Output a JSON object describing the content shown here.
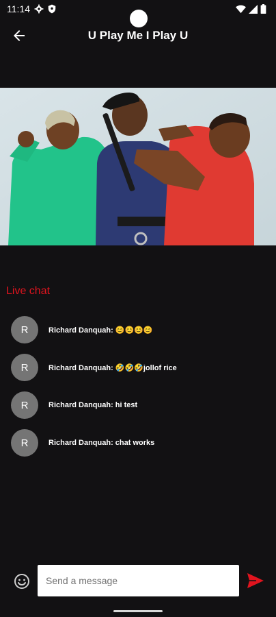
{
  "status_bar": {
    "time": "11:14",
    "icons": [
      "settings-icon",
      "shield-icon",
      "wifi-icon",
      "signal-icon",
      "battery-icon"
    ]
  },
  "app_bar": {
    "back_icon": "arrow-left-icon",
    "title": "U Play Me I Play U"
  },
  "hero_image": {
    "description_icon": "movie-poster"
  },
  "live_chat": {
    "heading": "Live chat",
    "messages": [
      {
        "avatar": "R",
        "text": "Richard Danquah: 😊😊😊😊"
      },
      {
        "avatar": "R",
        "text": "Richard Danquah: 🤣🤣🤣jollof rice"
      },
      {
        "avatar": "R",
        "text": "Richard Danquah: hi test"
      },
      {
        "avatar": "R",
        "text": "Richard Danquah: chat works"
      }
    ]
  },
  "composer": {
    "emoji_icon": "emoji-smile-icon",
    "placeholder": "Send a message",
    "value": "",
    "send_icon": "send-icon"
  },
  "colors": {
    "background": "#121113",
    "accent_red": "#e0141e",
    "avatar_gray": "#757575"
  }
}
